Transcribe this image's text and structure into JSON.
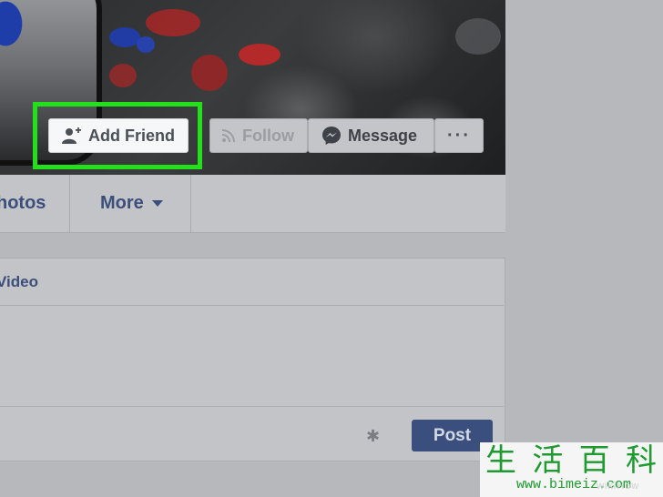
{
  "cover": {
    "actions": {
      "add_friend_label": "Add Friend",
      "follow_label": "Follow",
      "message_label": "Message",
      "more_label": "···"
    },
    "highlight_color": "#22e01a"
  },
  "nav": {
    "photos_label": "hotos",
    "more_label": "More"
  },
  "composer": {
    "header_label": "Video",
    "post_label": "Post"
  },
  "icons": {
    "add_friend": "add-friend-icon",
    "follow": "rss-icon",
    "message": "messenger-icon",
    "settings": "gear-icon",
    "dropdown": "caret-down-icon"
  },
  "watermark": {
    "chars": [
      "生",
      "活",
      "百",
      "科"
    ],
    "url": "www.bimeiz.com",
    "faint": "wikiHow"
  }
}
